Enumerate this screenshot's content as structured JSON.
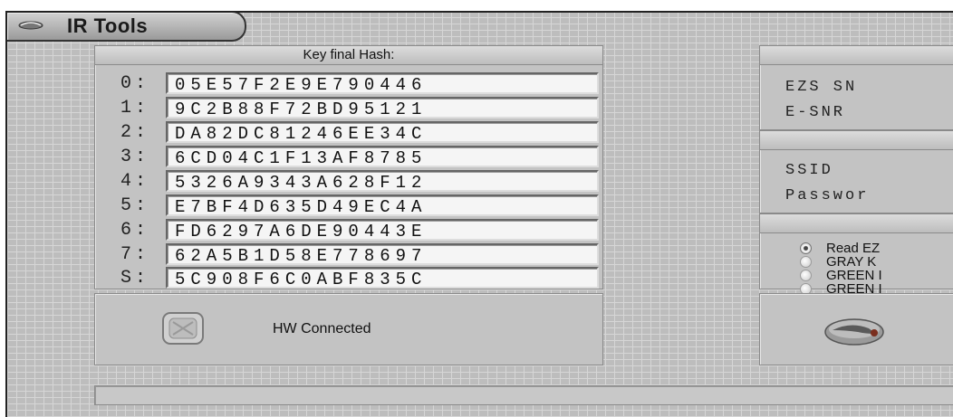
{
  "window": {
    "title": "IR Tools"
  },
  "hash_panel": {
    "header": "Key final Hash:",
    "rows": [
      {
        "index": "0:",
        "value": "05E57F2E9E790446"
      },
      {
        "index": "1:",
        "value": "9C2B88F72BD95121"
      },
      {
        "index": "2:",
        "value": "DA82DC81246EE34C"
      },
      {
        "index": "3:",
        "value": "6CD04C1F13AF8785"
      },
      {
        "index": "4:",
        "value": "5326A9343A628F12"
      },
      {
        "index": "5:",
        "value": "E7BF4D635D49EC4A"
      },
      {
        "index": "6:",
        "value": "FD6297A6DE90443E"
      },
      {
        "index": "7:",
        "value": "62A5B1D58E778697"
      },
      {
        "index": "S:",
        "value": "5C908F6C0ABF835C"
      }
    ]
  },
  "hw_status": {
    "label": "HW Connected",
    "icon": "hardware-status-icon"
  },
  "ezs_panel": {
    "ezs_sn_label": "EZS  SN",
    "esnr_label": "E-SNR"
  },
  "ssid_panel": {
    "ssid_label": "SSID",
    "password_label": "Passwor"
  },
  "options_panel": {
    "options": [
      {
        "label": "Read EZ",
        "selected": true
      },
      {
        "label": "GRAY K",
        "selected": false
      },
      {
        "label": "GREEN I",
        "selected": false
      },
      {
        "label": "GREEN I",
        "selected": false
      }
    ]
  },
  "action": {
    "icon": "key-icon"
  }
}
